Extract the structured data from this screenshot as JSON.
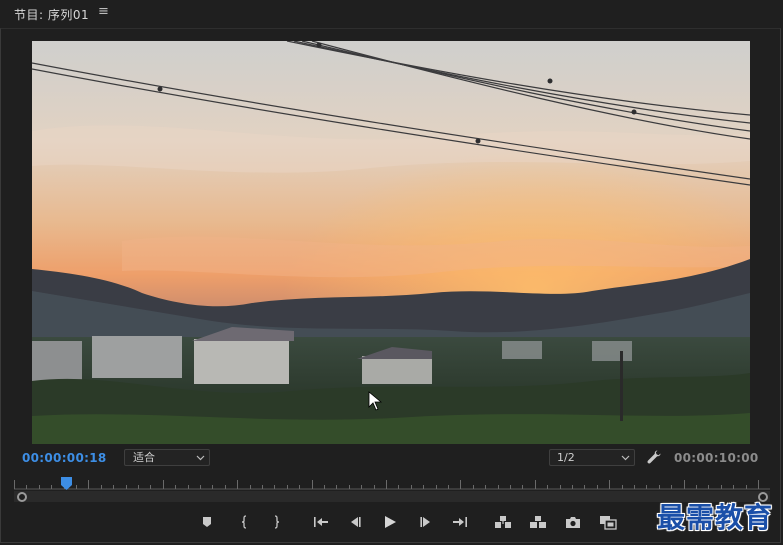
{
  "panel": {
    "title": "节目: 序列01",
    "menu_icon": "hamburger-menu-icon"
  },
  "monitor": {
    "current_timecode": "00:00:00:18",
    "zoom_select": "适合",
    "resolution_select": "1/2",
    "duration_timecode": "00:00:10:00",
    "playhead_position": 0.07
  },
  "transport": {
    "buttons": [
      "add-marker",
      "mark-in",
      "mark-out",
      "go-to-in",
      "step-back",
      "play",
      "step-forward",
      "go-to-out",
      "lift",
      "extract",
      "export-frame",
      "compare-view"
    ]
  },
  "watermark": {
    "text": "最需教育"
  },
  "colors": {
    "accent_timecode": "#3d8ee5",
    "panel_bg": "#1f1f1f",
    "watermark": "#1a4fa8"
  }
}
